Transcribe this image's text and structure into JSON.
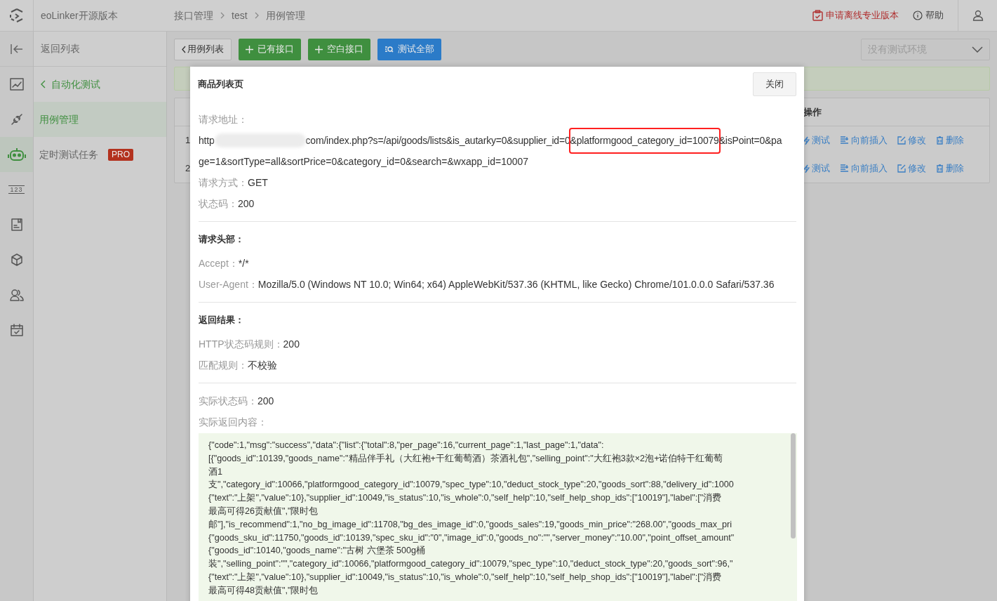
{
  "topbar": {
    "product": "eoLinker开源版本",
    "breadcrumb": [
      "接口管理",
      "test",
      "用例管理"
    ],
    "upgrade_link": "申请离线专业版本",
    "help_link": "帮助"
  },
  "rail": [
    {
      "kind": "chart",
      "selected": false
    },
    {
      "kind": "plug",
      "selected": false
    },
    {
      "kind": "robot",
      "selected": true
    },
    {
      "kind": "numbers",
      "text": "123",
      "selected": false
    },
    {
      "kind": "doc",
      "selected": false
    },
    {
      "kind": "cube",
      "selected": false
    },
    {
      "kind": "users",
      "selected": false
    },
    {
      "kind": "calendar",
      "selected": false
    }
  ],
  "sidebar": {
    "back": "返回列表",
    "group": "自动化测试",
    "items": [
      {
        "label": "用例管理",
        "selected": true
      },
      {
        "label": "定时测试任务",
        "badge": "PRO",
        "selected": false
      }
    ]
  },
  "toolbar": {
    "buttons": [
      {
        "kind": "back",
        "label": "用例列表"
      },
      {
        "kind": "add",
        "label": "已有接口"
      },
      {
        "kind": "add",
        "label": "空白接口"
      },
      {
        "kind": "run",
        "label": "测试全部"
      }
    ],
    "environment": {
      "placeholder": "没有测试环境"
    }
  },
  "table": {
    "action_header": "操作",
    "rows": [
      {
        "index": "1",
        "actions": [
          "测试",
          "向前插入",
          "修改",
          "删除"
        ]
      },
      {
        "index": "2",
        "actions": [
          "测试",
          "向前插入",
          "修改",
          "删除"
        ]
      }
    ]
  },
  "modal": {
    "title": "商品列表页",
    "close": "关闭",
    "request_url": {
      "label": "请求地址：",
      "prefix": "http",
      "segments": [
        {
          "text": "com/index.php?s=/api/goods/lists&is_autarky=0&supplier_id=0",
          "highlighted": false
        },
        {
          "text": "&platformgood_category_id=10079",
          "highlighted": true
        },
        {
          "text": "&isPoint=0&pa",
          "highlighted": false
        }
      ],
      "line_2": "ge=1&sortType=all&sortPrice=0&category_id=0&search=&wxapp_id=10007"
    },
    "sections": [
      {
        "fields": [
          {
            "label": "请求方式：",
            "value": "GET"
          },
          {
            "label": "状态码：",
            "value": "200"
          }
        ]
      },
      {
        "heading": "请求头部：",
        "fields": [
          {
            "label": "Accept：",
            "value": "*/*"
          },
          {
            "label": "User-Agent：",
            "value": "Mozilla/5.0 (Windows NT 10.0; Win64; x64) AppleWebKit/537.36 (KHTML, like Gecko) Chrome/101.0.0.0 Safari/537.36"
          }
        ]
      },
      {
        "heading": "返回结果：",
        "fields": [
          {
            "label": "HTTP状态码规则：",
            "value": "200"
          },
          {
            "label": "匹配规则：",
            "value": "不校验"
          }
        ]
      },
      {
        "fields": [
          {
            "label": "实际状态码：",
            "value": "200"
          },
          {
            "label": "实际返回内容："
          }
        ]
      }
    ],
    "response_lines": [
      "{\"code\":1,\"msg\":\"success\",\"data\":{\"list\":{\"total\":8,\"per_page\":16,\"current_page\":1,\"last_page\":1,\"data\":",
      "[{\"goods_id\":10139,\"goods_name\":\"精品伴手礼（大红袍+干红葡萄酒）茶酒礼包\",\"selling_point\":\"大红袍3款×2泡+诺伯特干红葡萄",
      "酒1",
      "支\",\"category_id\":10066,\"platformgood_category_id\":10079,\"spec_type\":10,\"deduct_stock_type\":20,\"goods_sort\":88,\"delivery_id\":1000",
      "{\"text\":\"上架\",\"value\":10},\"supplier_id\":10049,\"is_status\":10,\"is_whole\":0,\"self_help\":10,\"self_help_shop_ids\":[\"10019\"],\"label\":[\"消费",
      "最高可得26贡献值\",\"限时包",
      "邮\"],\"is_recommend\":1,\"no_bg_image_id\":11708,\"bg_des_image_id\":0,\"goods_sales\":19,\"goods_min_price\":\"268.00\",\"goods_max_pri",
      "{\"goods_sku_id\":11750,\"goods_id\":10139,\"spec_sku_id\":\"0\",\"image_id\":0,\"goods_no\":\"\",\"server_money\":\"10.00\",\"point_offset_amount\"",
      "{\"goods_id\":10140,\"goods_name\":\"古树 六堡茶 500g桶",
      "装\",\"selling_point\":\"\",\"category_id\":10066,\"platformgood_category_id\":10079,\"spec_type\":10,\"deduct_stock_type\":20,\"goods_sort\":96,\"",
      "{\"text\":\"上架\",\"value\":10},\"supplier_id\":10049,\"is_status\":10,\"is_whole\":0,\"self_help\":10,\"self_help_shop_ids\":[\"10019\"],\"label\":[\"消费",
      "最高可得48贡献值\",\"限时包"
    ]
  }
}
